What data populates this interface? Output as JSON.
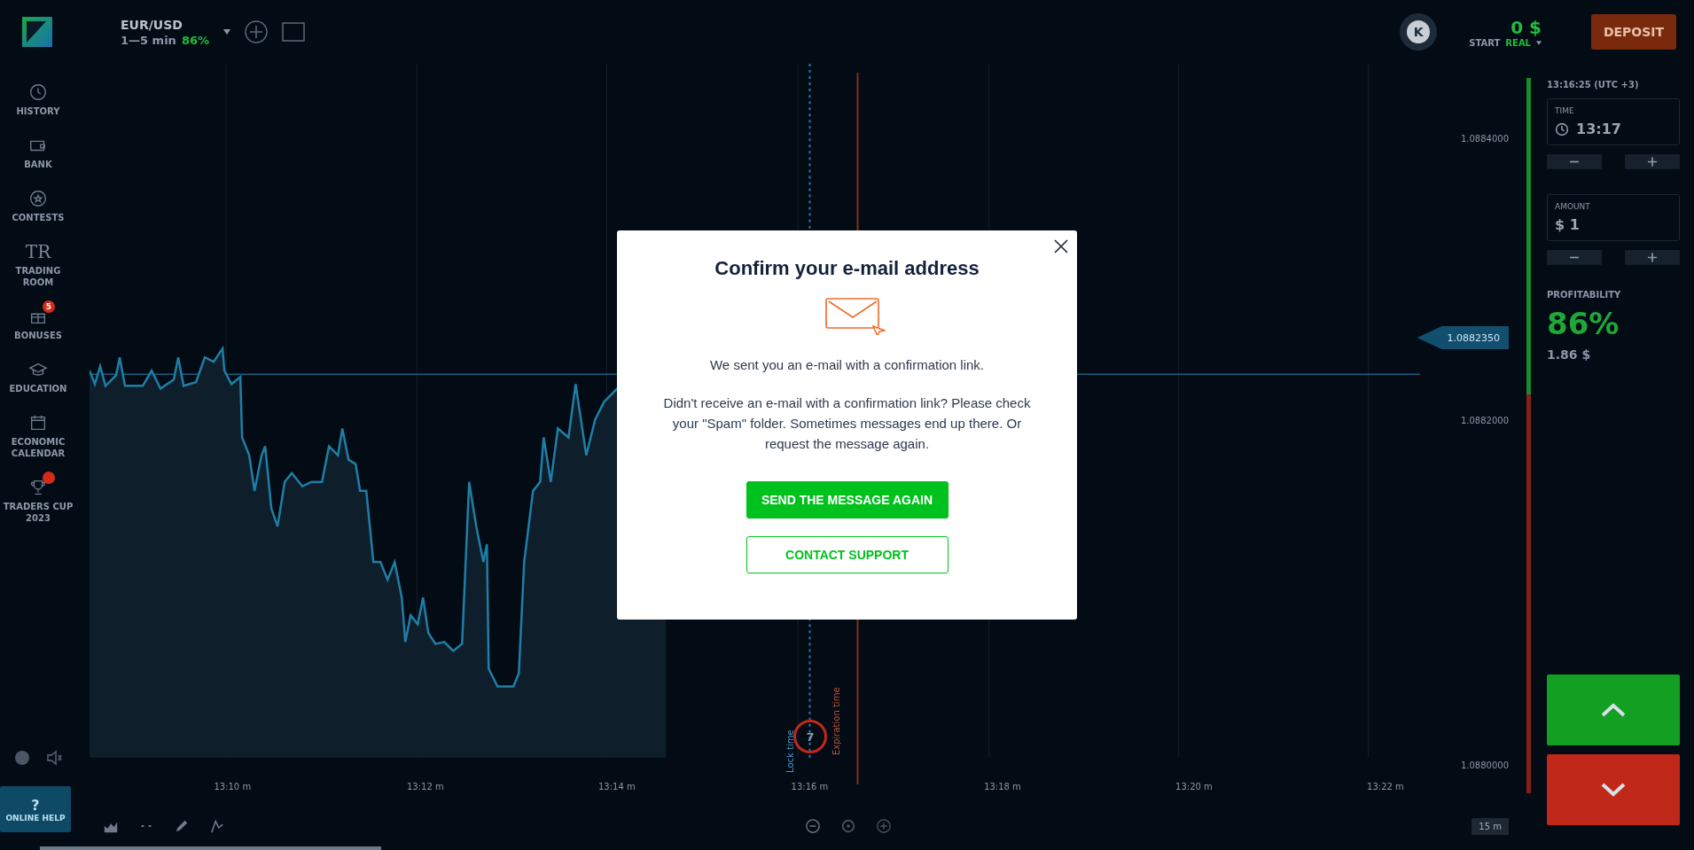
{
  "header": {
    "asset": "EUR/USD",
    "duration": "1—5 min",
    "payout": "86%",
    "avatar": "K",
    "balance": "0 $",
    "account_label": "START",
    "account_type": "REAL",
    "deposit": "DEPOSIT"
  },
  "sidebar": {
    "items": [
      {
        "label": "HISTORY",
        "kind": "clock",
        "notice": false
      },
      {
        "label": "BANK",
        "kind": "wallet",
        "notice": false
      },
      {
        "label": "CONTESTS",
        "kind": "star",
        "notice": false
      },
      {
        "label": "TRADING ROOM",
        "kind": "glyph",
        "glyph": "TR",
        "notice": false
      },
      {
        "label": "BONUSES",
        "kind": "gift",
        "notice": true,
        "count": "5"
      },
      {
        "label": "EDUCATION",
        "kind": "cap",
        "notice": false
      },
      {
        "label": "ECONOMIC CALENDAR",
        "kind": "calendar",
        "notice": false
      },
      {
        "label": "TRADERS CUP 2023",
        "kind": "cup",
        "notice": true
      }
    ],
    "help": {
      "glyph": "?",
      "label": "ONLINE HELP"
    }
  },
  "chart": {
    "price_labels": [
      "1.0884000",
      "1.0882000",
      "1.0880000"
    ],
    "current_price": "1.0882350",
    "time_labels": [
      "13:10 m",
      "13:12 m",
      "13:14 m",
      "13:16 m",
      "13:18 m",
      "13:20 m",
      "13:22 m"
    ],
    "lock_label": "Lock time",
    "expiry_label": "Expiration time",
    "timer": "7",
    "period": "15 m"
  },
  "panel": {
    "clock": "13:16:25 (UTC +3)",
    "time_label": "TIME",
    "time_value": "13:17",
    "amount_label": "AMOUNT",
    "amount_value": "$ 1",
    "profit_label": "PROFITABILITY",
    "profit_percent": "86%",
    "profit_value": "1.86 $"
  },
  "modal": {
    "title": "Confirm your e-mail address",
    "message": "We sent you an e-mail with a confirmation link.",
    "hint": "Didn't receive an e-mail with a confirmation link? Please check your \"Spam\" folder. Sometimes messages end up there. Or request the message again.",
    "buttons": [
      {
        "label": "SEND THE MESSAGE AGAIN",
        "kind": "primary"
      },
      {
        "label": "CONTACT SUPPORT",
        "kind": "outline"
      }
    ]
  }
}
